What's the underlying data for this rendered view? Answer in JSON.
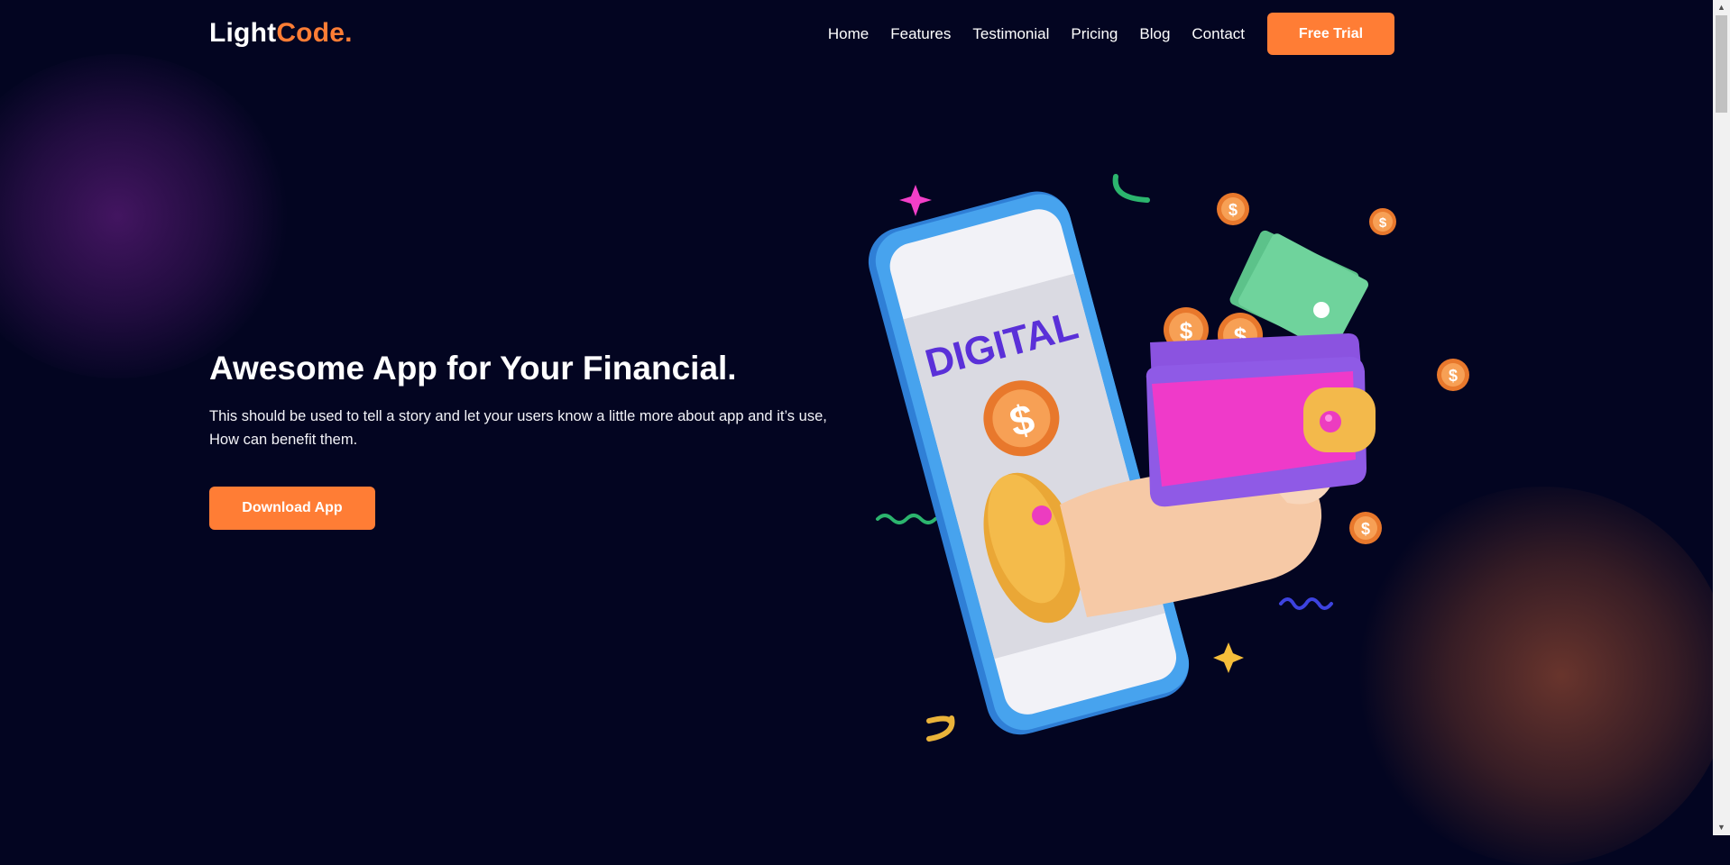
{
  "brand": {
    "name_main": "Light",
    "name_accent": "Code."
  },
  "nav": {
    "items": [
      "Home",
      "Features",
      "Testimonial",
      "Pricing",
      "Blog",
      "Contact"
    ],
    "cta_label": "Free Trial"
  },
  "hero": {
    "title": "Awesome App for Your Financial.",
    "description": "This should be used to tell a story and let your users know a little more about app and it’s use, How can benefit them.",
    "cta_label": "Download App"
  },
  "illustration": {
    "screen_text": "DIGITAL"
  },
  "colors": {
    "background": "#030521",
    "accent": "#ff7d35",
    "wallet": "#ee38c8",
    "phone": "#3a8fe0"
  },
  "icons": [
    "scroll-up-arrow-icon",
    "scroll-down-arrow-icon"
  ]
}
